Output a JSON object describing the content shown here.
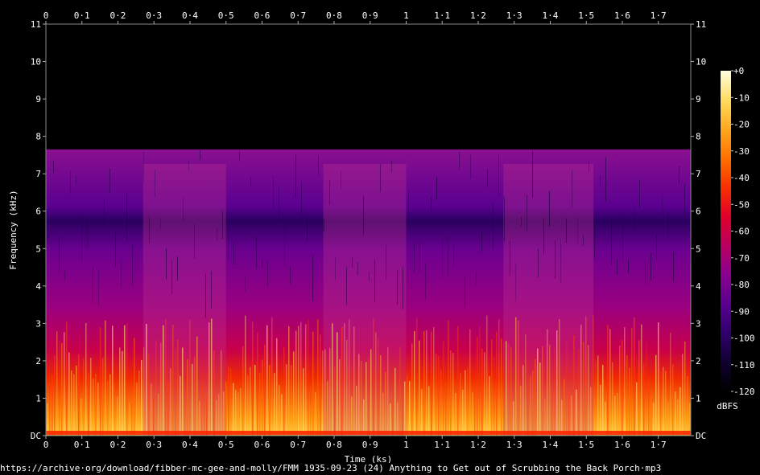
{
  "chart_data": {
    "type": "heatmap",
    "xlabel": "Time (ks)",
    "ylabel": "Frequency (kHz)",
    "xlim": [
      0,
      1.79
    ],
    "ylim": [
      0,
      11
    ],
    "x_ticks": [
      {
        "value": 0,
        "label": "0"
      },
      {
        "value": 0.1,
        "label": "0·1"
      },
      {
        "value": 0.2,
        "label": "0·2"
      },
      {
        "value": 0.3,
        "label": "0·3"
      },
      {
        "value": 0.4,
        "label": "0·4"
      },
      {
        "value": 0.5,
        "label": "0·5"
      },
      {
        "value": 0.6,
        "label": "0·6"
      },
      {
        "value": 0.7,
        "label": "0·7"
      },
      {
        "value": 0.8,
        "label": "0·8"
      },
      {
        "value": 0.9,
        "label": "0·9"
      },
      {
        "value": 1.0,
        "label": "1"
      },
      {
        "value": 1.1,
        "label": "1·1"
      },
      {
        "value": 1.2,
        "label": "1·2"
      },
      {
        "value": 1.3,
        "label": "1·3"
      },
      {
        "value": 1.4,
        "label": "1·4"
      },
      {
        "value": 1.5,
        "label": "1·5"
      },
      {
        "value": 1.6,
        "label": "1·6"
      },
      {
        "value": 1.7,
        "label": "1·7"
      }
    ],
    "y_ticks": [
      {
        "value": 0,
        "label": "DC"
      },
      {
        "value": 1,
        "label": "1"
      },
      {
        "value": 2,
        "label": "2"
      },
      {
        "value": 3,
        "label": "3"
      },
      {
        "value": 4,
        "label": "4"
      },
      {
        "value": 5,
        "label": "5"
      },
      {
        "value": 6,
        "label": "6"
      },
      {
        "value": 7,
        "label": "7"
      },
      {
        "value": 8,
        "label": "8"
      },
      {
        "value": 9,
        "label": "9"
      },
      {
        "value": 10,
        "label": "10"
      },
      {
        "value": 11,
        "label": "11"
      }
    ],
    "cutoff_khz": 7.65,
    "colorbar": {
      "unit": "dBFS",
      "range": [
        -120,
        0
      ],
      "ticks": [
        {
          "value": 0,
          "label": "+0"
        },
        {
          "value": -10,
          "label": "-10"
        },
        {
          "value": -20,
          "label": "-20"
        },
        {
          "value": -30,
          "label": "-30"
        },
        {
          "value": -40,
          "label": "-40"
        },
        {
          "value": -50,
          "label": "-50"
        },
        {
          "value": -60,
          "label": "-60"
        },
        {
          "value": -70,
          "label": "-70"
        },
        {
          "value": -80,
          "label": "-80"
        },
        {
          "value": -90,
          "label": "-90"
        },
        {
          "value": -100,
          "label": "-100"
        },
        {
          "value": -110,
          "label": "-110"
        },
        {
          "value": -120,
          "label": "-120"
        }
      ],
      "colors": [
        "#000000",
        "#100030",
        "#30006e",
        "#5a0090",
        "#8a0090",
        "#b80060",
        "#e0002a",
        "#f83000",
        "#ff7000",
        "#ffa820",
        "#ffdc60",
        "#ffffe0"
      ]
    },
    "bright_segments": [
      {
        "start": 0.27,
        "end": 0.5
      },
      {
        "start": 0.77,
        "end": 1.0
      },
      {
        "start": 1.27,
        "end": 1.52
      }
    ]
  },
  "source": "https://archive·org/download/fibber-mc-gee-and-molly/FMM 1935-09-23 (24) Anything to Get out of Scrubbing the Back Porch·mp3"
}
